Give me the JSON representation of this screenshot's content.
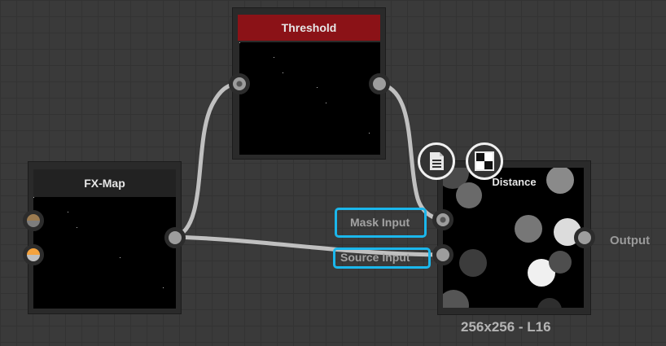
{
  "nodes": {
    "threshold": {
      "title": "Threshold",
      "title_color": "#8b1217"
    },
    "fxmap": {
      "title": "FX-Map"
    },
    "distance": {
      "title": "Distance",
      "size_label": "256x256 - L16",
      "output_label": "Output"
    }
  },
  "inputs": {
    "mask": "Mask Input",
    "source": "Source Input"
  },
  "icons": {
    "document": "document-icon",
    "checker": "checkerboard-icon"
  },
  "colors": {
    "highlight": "#1bb7ec",
    "wire": "#c8c8c8"
  }
}
